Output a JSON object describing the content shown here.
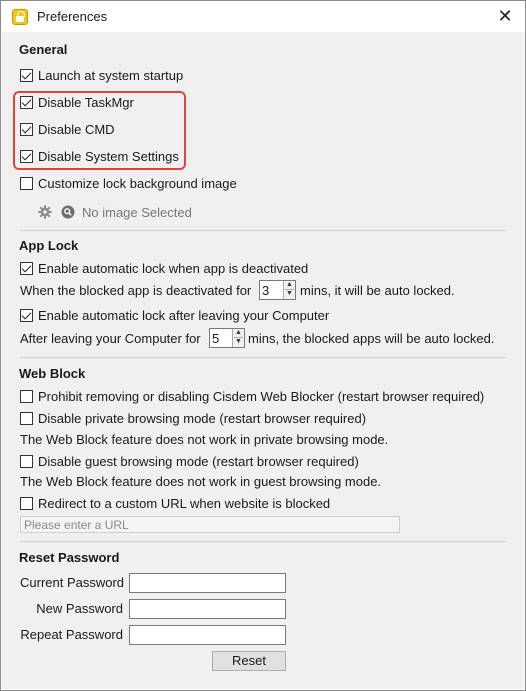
{
  "window": {
    "title": "Preferences",
    "close_glyph": "✕"
  },
  "general": {
    "title": "General",
    "launch_startup": {
      "label": "Launch at system startup",
      "checked": true
    },
    "disable_taskmgr": {
      "label": "Disable TaskMgr",
      "checked": true
    },
    "disable_cmd": {
      "label": "Disable CMD",
      "checked": true
    },
    "disable_system_settings": {
      "label": "Disable System Settings",
      "checked": true
    },
    "customize_bg": {
      "label": "Customize lock background image",
      "checked": false
    },
    "no_image_text": "No image Selected",
    "icons": [
      "gear-icon",
      "search-icon"
    ],
    "highlight_color": "#e0453b"
  },
  "app_lock": {
    "title": "App Lock",
    "auto_lock_deactivated": {
      "label": "Enable automatic lock when app is deactivated",
      "checked": true
    },
    "deactivated_prefix": "When the blocked app is deactivated for",
    "deactivated_value": "3",
    "deactivated_suffix": "mins, it will be auto locked.",
    "auto_lock_leave": {
      "label": "Enable automatic lock after leaving your Computer",
      "checked": true
    },
    "leave_prefix": "After leaving your Computer for",
    "leave_value": "5",
    "leave_suffix": "mins, the blocked apps will be auto locked."
  },
  "web_block": {
    "title": "Web Block",
    "prohibit_removing": {
      "label": "Prohibit removing or disabling Cisdem Web Blocker (restart browser required)",
      "checked": false
    },
    "disable_private": {
      "label": "Disable private browsing mode (restart browser required)",
      "checked": false
    },
    "private_note": "The Web Block feature does not work in private browsing mode.",
    "disable_guest": {
      "label": "Disable guest browsing mode (restart browser required)",
      "checked": false
    },
    "guest_note": "The Web Block feature does not work in guest browsing mode.",
    "redirect": {
      "label": "Redirect to a custom URL when website is blocked",
      "checked": false
    },
    "url_placeholder": "Please enter a URL"
  },
  "reset_password": {
    "title": "Reset Password",
    "current_label": "Current Password",
    "new_label": "New Password",
    "repeat_label": "Repeat Password",
    "reset_button": "Reset"
  }
}
